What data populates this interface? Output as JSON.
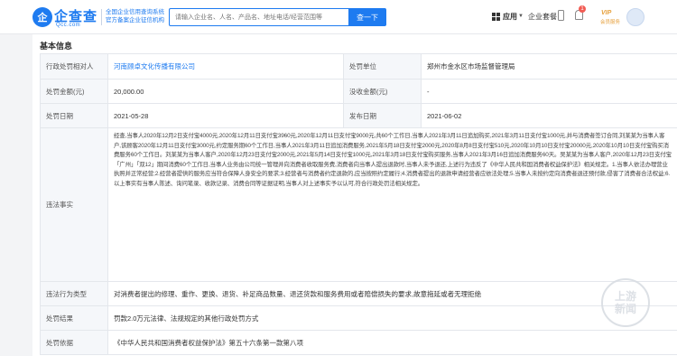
{
  "header": {
    "brand": "企查查",
    "domain": "Qcc.com",
    "slogan_line1": "全国企业信用查询系统",
    "slogan_line2": "官方备案企业征信机构",
    "search_placeholder": "请输入企业名、人名、产品名、地址电话/经营范围等",
    "search_button": "查一下",
    "app_label": "应用",
    "nav_link": "企业套餐",
    "notification_count": "1",
    "vip_text": "VIP",
    "vip_label": "会员服务"
  },
  "section_title": "基本信息",
  "rows": {
    "party": {
      "label": "行政处罚相对人",
      "value": "河南顾卓文化传播有限公司",
      "label2": "处罚单位",
      "value2": "郑州市金水区市场监督管理局"
    },
    "amount": {
      "label": "处罚金额(元)",
      "value": "20,000.00",
      "label2": "没收金额(元)",
      "value2": "-"
    },
    "date": {
      "label": "处罚日期",
      "value": "2021-05-28",
      "label2": "发布日期",
      "value2": "2021-06-02"
    },
    "facts": {
      "label": "违法事实",
      "text": "经查,当事人2020年12月2日支付宝4000元,2020年12月11日支付宝3960元,2020年12月11日支付宝9000元,共60个工作日,当事人2021年3月11日追加购买,2021年3月11日支付宝1000元,并与消费者签订合同,刘某某为当事人客户,该顾客2020年12月11日支付宝3000元,约定服务期60个工作日,当事人2021年3月11日追加消费服务,2021年5月18日支付宝2000元,2020年8月8日支付宝510元,2020年10月10日支付宝20000元,2020年10月10日支付宝购买消费服务60个工作日。刘某某为当事人客户,2020年12月23日支付宝2000元,2021年5月14日支付宝1000元,2021年3月18日支付宝购买服务,当事人2021年3月16日追加消费服务60天。吴某某为当事人客户,2020年12月23日支付宝「广州」「双12」期间消费60个工作日,当事人业务由公司统一管理并向消费者收取服务费,消费者向当事人提出退款时,当事人未予退还,上述行为违反了《中华人民共和国消费者权益保护法》相关规定。1.当事人依法办理营业执照并正常经营;2.经营者提供的服务应当符合保障人身安全的要求;3.经营者与消费者约定退款的,应当按照约定履行;4.消费者提出的退款申请经营者应依法处理;5.当事人未按约定向消费者退还预付款,侵害了消费者合法权益;6.以上事实有当事人陈述、询问笔录、收款记录、消费合同等证据证明,当事人对上述事实予以认可,符合行政处罚法相关规定。"
    },
    "type": {
      "label": "违法行为类型",
      "value": "对消费者提出的修理、重作、更换、退货、补足商品数量、退还货款和服务费用或者赔偿损失的要求,故意拖延或者无理拒绝"
    },
    "result": {
      "label": "处罚结果",
      "value": "罚款2.0万元法律、法规规定的其他行政处罚方式"
    },
    "basis": {
      "label": "处罚依据",
      "value": "《中华人民共和国消费者权益保护法》第五十六条第一款第八项"
    }
  },
  "watermark": "上游新闻",
  "colors": {
    "accent": "#1e7bf0",
    "label_bg": "#f5f7fa",
    "border": "#e4e7ec"
  }
}
